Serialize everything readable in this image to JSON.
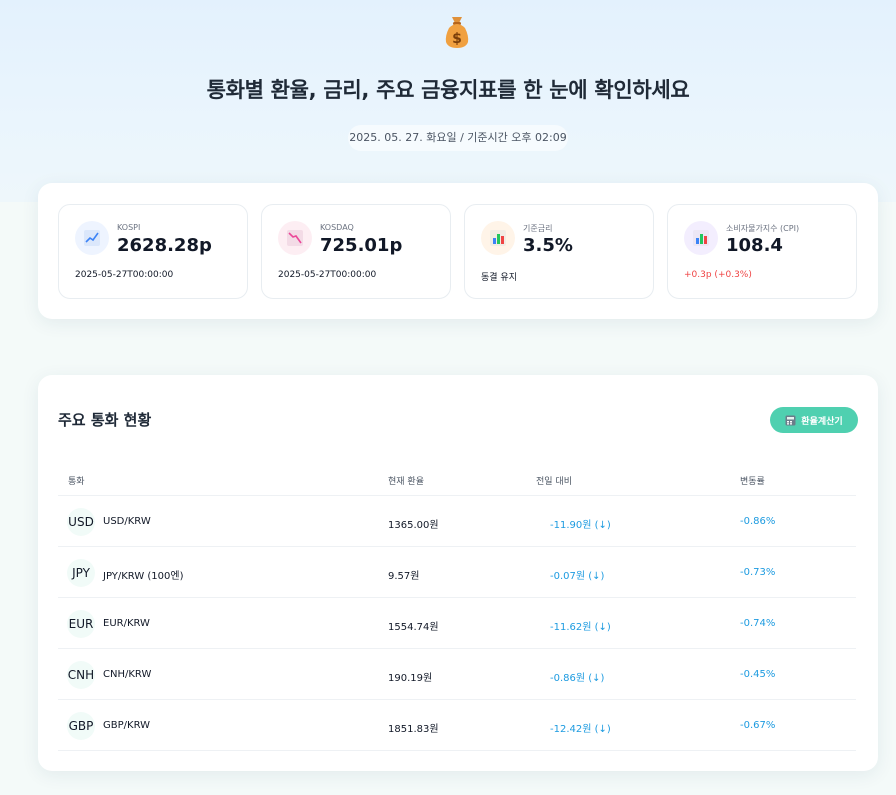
{
  "hero": {
    "icon": "money-bag-icon",
    "title": "통화별 환율, 금리, 주요 금융지표를 한 눈에 확인하세요",
    "date": "2025. 05. 27. 화요일 / 기준시간 오후 02:09"
  },
  "stats": [
    {
      "name": "KOSPI",
      "value": "2628.28p",
      "sub": "2025-05-27T00:00:00",
      "icon": "chart-up-icon",
      "accent": "#3b82f6"
    },
    {
      "name": "KOSDAQ",
      "value": "725.01p",
      "sub": "2025-05-27T00:00:00",
      "icon": "chart-down-icon",
      "accent": "#ec4899"
    },
    {
      "name": "기준금리",
      "value": "3.5%",
      "sub": "동결 유지",
      "icon": "bar-chart-icon",
      "accent": "#f59e0b"
    },
    {
      "name": "소비자물가지수 (CPI)",
      "value": "108.4",
      "sub": "+0.3p (+0.3%)",
      "icon": "bar-chart-icon",
      "accent": "#8b5cf6"
    }
  ],
  "currency_section": {
    "title": "주요 통화 현황",
    "calc_button": "환율계산기",
    "columns": [
      "통화",
      "현재 환율",
      "전일 대비",
      "변동률"
    ],
    "rows": [
      {
        "code": "USD",
        "pair": "USD/KRW",
        "rate": "1365.00원",
        "diff": "-11.90원 (↓)",
        "pct": "-0.86%"
      },
      {
        "code": "JPY",
        "pair": "JPY/KRW (100엔)",
        "rate": "9.57원",
        "diff": "-0.07원 (↓)",
        "pct": "-0.73%"
      },
      {
        "code": "EUR",
        "pair": "EUR/KRW",
        "rate": "1554.74원",
        "diff": "-11.62원 (↓)",
        "pct": "-0.74%"
      },
      {
        "code": "CNH",
        "pair": "CNH/KRW",
        "rate": "190.19원",
        "diff": "-0.86원 (↓)",
        "pct": "-0.45%"
      },
      {
        "code": "GBP",
        "pair": "GBP/KRW",
        "rate": "1851.83원",
        "diff": "-12.42원 (↓)",
        "pct": "-0.67%"
      }
    ]
  },
  "colors": {
    "accent": "#4fd0b0",
    "down": "#1d9be0",
    "up": "#ef4444"
  }
}
